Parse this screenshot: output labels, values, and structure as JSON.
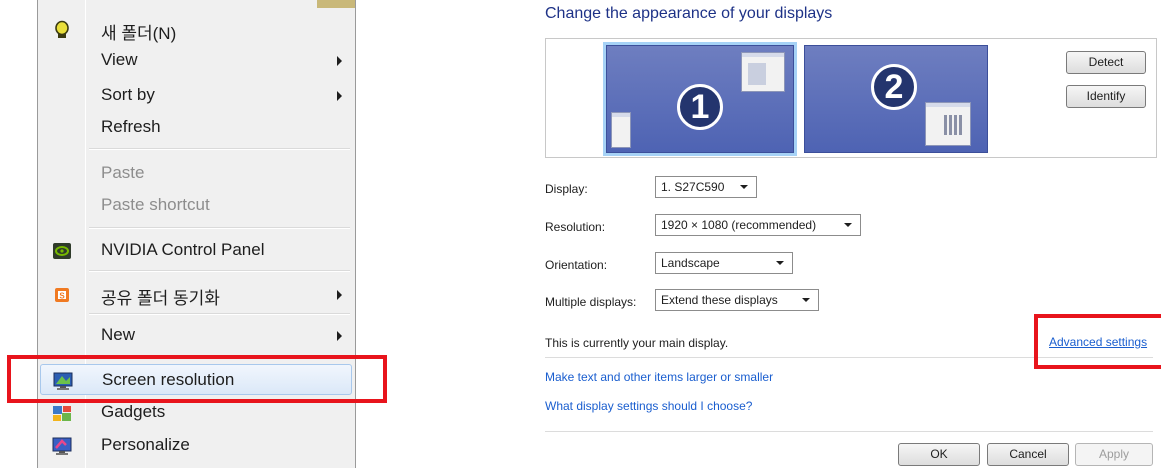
{
  "context_menu": {
    "items": [
      {
        "label": "새 폴더(N)"
      },
      {
        "label": "View"
      },
      {
        "label": "Sort by"
      },
      {
        "label": "Refresh"
      },
      {
        "label": "Paste"
      },
      {
        "label": "Paste shortcut"
      },
      {
        "label": "NVIDIA Control Panel"
      },
      {
        "label": "공유 폴더 동기화"
      },
      {
        "label": "New"
      },
      {
        "label": "Screen resolution"
      },
      {
        "label": "Gadgets"
      },
      {
        "label": "Personalize"
      }
    ],
    "icons": [
      "folder-bulb-icon",
      "nvidia-icon",
      "share-sync-icon",
      "screen-resolution-icon",
      "gadgets-icon",
      "personalize-icon"
    ],
    "highlighted_item": "Screen resolution"
  },
  "display_settings": {
    "title": "Change the appearance of your displays",
    "monitors": [
      "1",
      "2"
    ],
    "detect_label": "Detect",
    "identify_label": "Identify",
    "display_label": "Display:",
    "display_value": "1. S27C590",
    "resolution_label": "Resolution:",
    "resolution_value": "1920 × 1080 (recommended)",
    "orientation_label": "Orientation:",
    "orientation_value": "Landscape",
    "multiple_label": "Multiple displays:",
    "multiple_value": "Extend these displays",
    "main_display_text": "This is currently your main display.",
    "advanced_link": "Advanced settings",
    "link_text_size": "Make text and other items larger or smaller",
    "link_help": "What display settings should I choose?",
    "ok_label": "OK",
    "cancel_label": "Cancel",
    "apply_label": "Apply"
  },
  "colors": {
    "annotation_red": "#e8141c",
    "link_blue": "#1a5ecf",
    "monitor_blue": "#5a6db8"
  }
}
